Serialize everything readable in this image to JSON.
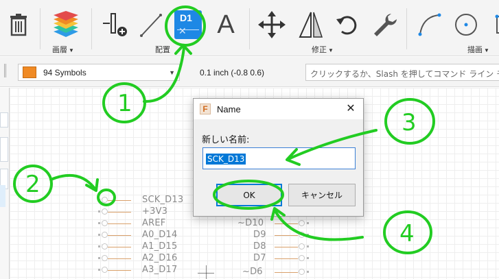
{
  "toolbar": {
    "groups": {
      "layer": "画層",
      "place": "配置",
      "modify": "修正",
      "draw": "描画"
    },
    "tools": {
      "delete": "trash-icon",
      "layers": "layers-stack-icon",
      "add_pin": "pin-add-icon",
      "line": "line-icon",
      "name_tool": "D1",
      "text": "A",
      "move": "move-arrows-icon",
      "mirror": "mirror-icon",
      "rotate": "rotate-icon",
      "wrench": "wrench-icon",
      "arc": "arc-icon",
      "circle": "circle-icon"
    }
  },
  "options": {
    "layer_name": "94 Symbols",
    "layer_color": "#f08a24",
    "grid_info": "0.1 inch (-0.8 0.6)",
    "command_placeholder": "クリックするか、Slash を押してコマンド ライン モ"
  },
  "canvas": {
    "pins_left": [
      "SCK_D13",
      "+3V3",
      "AREF",
      "A0_D14",
      "A1_D15",
      "A2_D16",
      "A3_D17"
    ],
    "pins_right": [
      "~D10",
      "D9",
      "D8",
      "D7",
      "~D6"
    ]
  },
  "dialog": {
    "title": "Name",
    "close_glyph": "✕",
    "app_icon_letter": "F",
    "field_label": "新しい名前:",
    "field_value": "SCK_D13",
    "ok_label": "OK",
    "cancel_label": "キャンセル"
  },
  "annotations": {
    "numbers": [
      "1",
      "2",
      "3",
      "4"
    ],
    "color": "#22cc22"
  }
}
